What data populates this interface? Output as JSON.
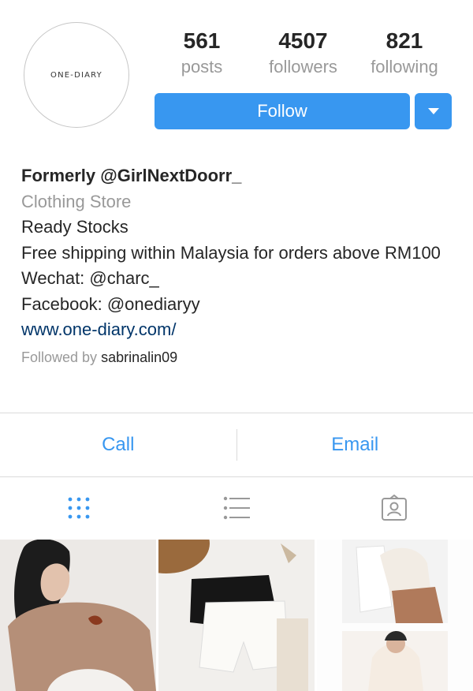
{
  "profile": {
    "avatar_text": "ONE-DIARY",
    "stats": [
      {
        "value": "561",
        "label": "posts"
      },
      {
        "value": "4507",
        "label": "followers"
      },
      {
        "value": "821",
        "label": "following"
      }
    ],
    "follow_label": "Follow",
    "dropdown_icon": "caret-down-icon"
  },
  "bio": {
    "name": "Formerly @GirlNextDoorr_",
    "category": "Clothing Store",
    "lines": [
      "Ready Stocks",
      "Free shipping within Malaysia for orders above RM100",
      "Wechat: @charc_",
      "Facebook: @onediaryy"
    ],
    "link": "www.one-diary.com/",
    "followed_by_prefix": "Followed by",
    "followed_by_user": "sabrinalin09"
  },
  "contact": {
    "call_label": "Call",
    "email_label": "Email"
  },
  "tabs": [
    {
      "icon": "grid-icon",
      "active": true
    },
    {
      "icon": "list-icon",
      "active": false
    },
    {
      "icon": "tagged-icon",
      "active": false
    }
  ],
  "colors": {
    "accent": "#3897f0",
    "muted": "#999999",
    "link": "#003569",
    "divider": "#dbdbdb"
  }
}
